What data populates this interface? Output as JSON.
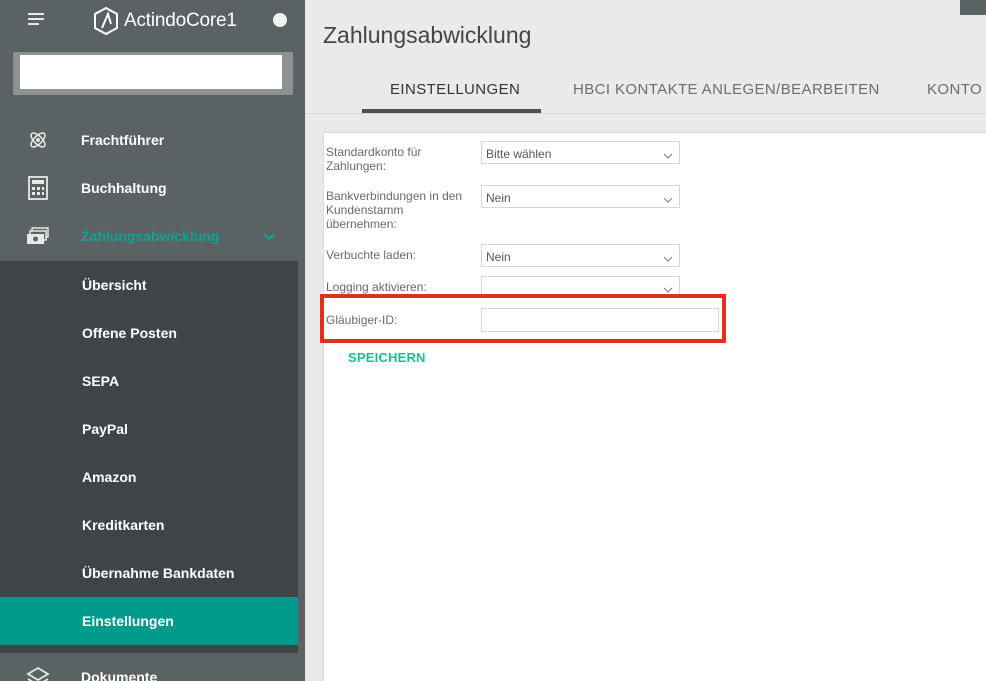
{
  "app": {
    "logo_text": "ActindoCore1"
  },
  "sidebar": {
    "search_placeholder": "",
    "nav": [
      {
        "label": "Frachtführer",
        "icon": "atom-icon"
      },
      {
        "label": "Buchhaltung",
        "icon": "calculator-icon"
      },
      {
        "label": "Zahlungsabwicklung",
        "icon": "money-icon",
        "active": true,
        "expanded": true
      }
    ],
    "submenu": [
      {
        "label": "Übersicht"
      },
      {
        "label": "Offene Posten"
      },
      {
        "label": "SEPA"
      },
      {
        "label": "PayPal"
      },
      {
        "label": "Amazon"
      },
      {
        "label": "Kreditkarten"
      },
      {
        "label": "Übernahme Bankdaten"
      },
      {
        "label": "Einstellungen",
        "selected": true
      }
    ],
    "bottom_nav": {
      "label": "Dokumente",
      "icon": "layers-icon"
    }
  },
  "header": {
    "title": "Zahlungsabwicklung",
    "tabs": [
      {
        "label": "EINSTELLUNGEN",
        "active": true
      },
      {
        "label": "HBCI KONTAKTE ANLEGEN/BEARBEITEN"
      },
      {
        "label": "KONTO A"
      }
    ]
  },
  "form": {
    "fields": [
      {
        "label": "Standardkonto für Zahlungen:",
        "type": "select",
        "value": "Bitte wählen"
      },
      {
        "label": "Bankverbindungen in den Kundenstamm übernehmen:",
        "type": "select",
        "value": "Nein"
      },
      {
        "label": "Verbuchte laden:",
        "type": "select",
        "value": "Nein"
      },
      {
        "label": "Logging aktivieren:",
        "type": "select",
        "value": ""
      },
      {
        "label": "Gläubiger-ID:",
        "type": "text",
        "value": ""
      }
    ],
    "save_label": "SPEICHERN"
  },
  "colors": {
    "sidebar_bg": "#5b6263",
    "submenu_bg": "#3f4546",
    "accent": "#009a8d",
    "highlight": "#e0301e",
    "save_text": "#1abc9c"
  }
}
